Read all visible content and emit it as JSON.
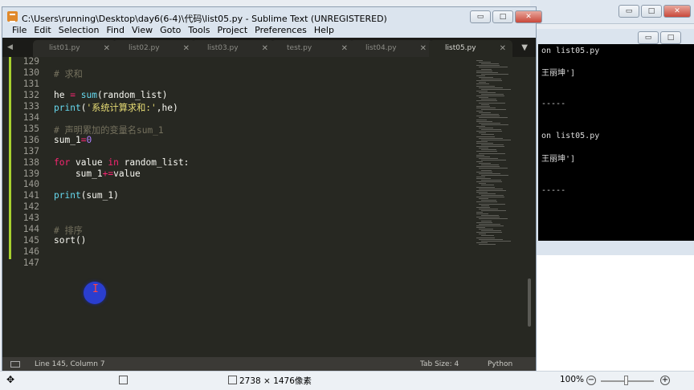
{
  "window": {
    "title": "C:\\Users\\running\\Desktop\\day6(6-4)\\代码\\list05.py - Sublime Text (UNREGISTERED)",
    "controls": {
      "minimize": "▭",
      "maximize": "□",
      "close": "✕"
    }
  },
  "menu": [
    "File",
    "Edit",
    "Selection",
    "Find",
    "View",
    "Goto",
    "Tools",
    "Project",
    "Preferences",
    "Help"
  ],
  "tabs": [
    {
      "label": "list01.py",
      "active": false
    },
    {
      "label": "list02.py",
      "active": false
    },
    {
      "label": "list03.py",
      "active": false
    },
    {
      "label": "test.py",
      "active": false
    },
    {
      "label": "list04.py",
      "active": false
    },
    {
      "label": "list05.py",
      "active": true
    }
  ],
  "tab_close": "✕",
  "editor": {
    "lines": [
      {
        "n": "129",
        "html": ""
      },
      {
        "n": "130",
        "html": "<span class='cm'># 求和</span>"
      },
      {
        "n": "131",
        "html": ""
      },
      {
        "n": "132",
        "html": "he <span class='kw'>=</span> <span class='fn'>sum</span>(random_list)"
      },
      {
        "n": "133",
        "html": "<span class='fn'>print</span>(<span class='str'>'系统计算求和:'</span>,he)"
      },
      {
        "n": "134",
        "html": ""
      },
      {
        "n": "135",
        "html": "<span class='cm'># 声明累加的变量名sum_1</span>"
      },
      {
        "n": "136",
        "html": "sum_1<span class='kw'>=</span><span class='num'>0</span>"
      },
      {
        "n": "137",
        "html": ""
      },
      {
        "n": "138",
        "html": "<span class='kw'>for</span> value <span class='kw'>in</span> random_list:"
      },
      {
        "n": "139",
        "html": "    sum_1<span class='kw'>+=</span>value"
      },
      {
        "n": "140",
        "html": ""
      },
      {
        "n": "141",
        "html": "<span class='fn'>print</span>(sum_1)"
      },
      {
        "n": "142",
        "html": ""
      },
      {
        "n": "143",
        "html": ""
      },
      {
        "n": "144",
        "html": "<span class='cm'># 排序</span>"
      },
      {
        "n": "145",
        "html": "sort()"
      },
      {
        "n": "146",
        "html": ""
      },
      {
        "n": "147",
        "html": ""
      }
    ]
  },
  "status": {
    "position": "Line 145, Column 7",
    "tab_size": "Tab Size: 4",
    "syntax": "Python"
  },
  "console": {
    "lines": [
      "on list05.py",
      "王丽坤']",
      "-----",
      "on list05.py",
      "王丽坤']",
      "-----"
    ]
  },
  "viewer": {
    "dimensions": "2738 × 1476像素",
    "zoom": "100%",
    "zoom_minus": "−",
    "zoom_plus": "+"
  }
}
